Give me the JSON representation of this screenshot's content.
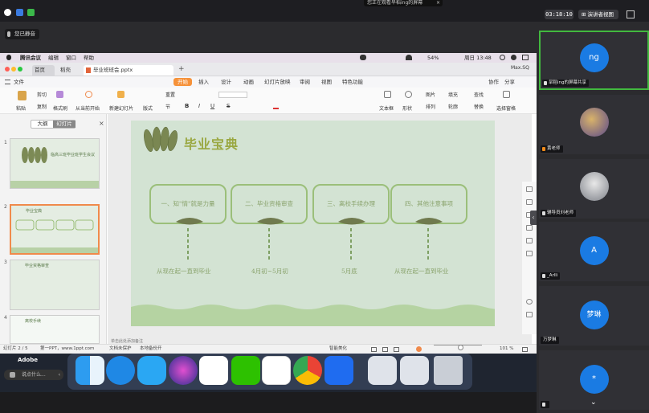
{
  "topbar": {
    "share_banner": "您正在观看旱稻ing的屏幕",
    "share_close": "×",
    "timer": "03:18:10",
    "view_label": "⊞ 演讲者视图",
    "mute_label": "您已静音"
  },
  "mac_menubar": {
    "apple": "",
    "app": "腾讯会议",
    "items": [
      "编辑",
      "窗口",
      "帮助"
    ],
    "battery": "54%",
    "clock": "周日 13:48"
  },
  "wps": {
    "tabs": [
      "首页",
      "稻壳",
      "毕业班班会.pptx"
    ],
    "file_tab": "毕业班班会.pptx",
    "user": "Max.SQ",
    "menu": {
      "file": "文件",
      "ribbon_tabs": [
        "开始",
        "插入",
        "设计",
        "动画",
        "幻灯片放映",
        "审阅",
        "视图",
        "特色功能"
      ],
      "active_tab": "开始",
      "right": [
        "协作",
        "分享"
      ]
    },
    "ribbon": {
      "paste": "粘贴",
      "cut": "剪切",
      "copy": "复制",
      "format_painter": "格式刷",
      "play_from_start": "从当前开始",
      "new_slide": "新建幻灯片",
      "layout": "版式",
      "reset": "重置",
      "section": "节",
      "bold": "B",
      "italic": "I",
      "underline": "U",
      "strike": "S",
      "textbox": "文本框",
      "shape": "形状",
      "picture": "图片",
      "fill": "填充",
      "arrange": "排列",
      "outline": "轮廓",
      "find": "查找",
      "replace": "替换",
      "select_pane": "选择窗格"
    },
    "left_pane": {
      "tab_outline": "大纲",
      "tab_slides": "幻灯片",
      "close": "×",
      "thumb_numbers": [
        "1",
        "2",
        "3",
        "4"
      ],
      "thumb_titles": [
        "临高三班毕业班学生会议",
        "毕业宝典",
        "毕业资格审查",
        "离校手续"
      ],
      "add": "+"
    },
    "slide": {
      "title": "毕业宝典",
      "boxes": [
        "一、知\"情\"就是力量",
        "二、毕业资格审查",
        "三、离校手续办理",
        "四、其他注意事项"
      ],
      "timeline": [
        "从现在起一直到毕业",
        "4月初~5月初",
        "5月底",
        "从现在起一直到毕业"
      ]
    },
    "notes_placeholder": "单击此处添加备注",
    "status": {
      "slide_index": "幻灯片 2 / 5",
      "theme": "第一PPT，www.1ppt.com",
      "doc_protect": "文档未保护",
      "backup": "本地备份开",
      "beautify": "智能美化",
      "zoom": "101 %"
    }
  },
  "dock": {
    "adobe_title": "Adobe",
    "mini_label": "说点什么...",
    "mini_chevron": "‹"
  },
  "participants": [
    {
      "name": "旱稻ing的屏幕共享",
      "avatar": "ng",
      "avatar_color": "#1a7be3"
    },
    {
      "name": "黄老师",
      "avatar": "",
      "avatar_color": "#6b5a8e"
    },
    {
      "name": "辅导员刘老师",
      "avatar": "",
      "avatar_color": "#9aa0a8"
    },
    {
      "name": "_Arlli",
      "avatar": "A",
      "avatar_color": "#1a7be3"
    },
    {
      "name": "万梦琳",
      "avatar": "梦琳",
      "avatar_color": "#1a7be3"
    },
    {
      "name": "",
      "avatar": "*",
      "avatar_color": "#1a7be3"
    }
  ],
  "panel_more": "⌄",
  "panel_tab": "‹"
}
